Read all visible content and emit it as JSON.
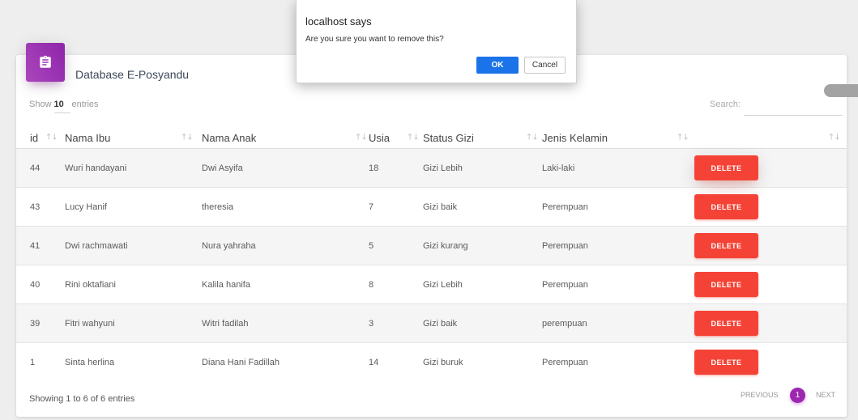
{
  "dialog": {
    "title": "localhost says",
    "message": "Are you sure you want to remove this?",
    "ok_label": "OK",
    "cancel_label": "Cancel"
  },
  "card": {
    "icon": "clipboard-icon",
    "title": "Database E-Posyandu"
  },
  "controls": {
    "show_label": "Show",
    "page_length": "10",
    "entries_label": "entries",
    "search_label": "Search:",
    "search_value": ""
  },
  "table": {
    "sort_icon": "sort-both-icon",
    "columns": [
      {
        "key": "id",
        "label": "id"
      },
      {
        "key": "nama_ibu",
        "label": "Nama Ibu"
      },
      {
        "key": "nama_anak",
        "label": "Nama Anak"
      },
      {
        "key": "usia",
        "label": "Usia"
      },
      {
        "key": "status_gizi",
        "label": "Status Gizi"
      },
      {
        "key": "jenis_kelamin",
        "label": "Jenis Kelamin"
      },
      {
        "key": "action",
        "label": ""
      }
    ],
    "rows": [
      {
        "id": "44",
        "nama_ibu": "Wuri handayani",
        "nama_anak": "Dwi Asyifa",
        "usia": "18",
        "status_gizi": "Gizi Lebih",
        "jenis_kelamin": "Laki-laki",
        "action": "DELETE"
      },
      {
        "id": "43",
        "nama_ibu": "Lucy Hanif",
        "nama_anak": "theresia",
        "usia": "7",
        "status_gizi": "Gizi baik",
        "jenis_kelamin": "Perempuan",
        "action": "DELETE"
      },
      {
        "id": "41",
        "nama_ibu": "Dwi rachmawati",
        "nama_anak": "Nura yahraha",
        "usia": "5",
        "status_gizi": "Gizi kurang",
        "jenis_kelamin": "Perempuan",
        "action": "DELETE"
      },
      {
        "id": "40",
        "nama_ibu": "Rini oktafiani",
        "nama_anak": "Kalila hanifa",
        "usia": "8",
        "status_gizi": "Gizi Lebih",
        "jenis_kelamin": "Perempuan",
        "action": "DELETE"
      },
      {
        "id": "39",
        "nama_ibu": "Fitri wahyuni",
        "nama_anak": "Witri fadilah",
        "usia": "3",
        "status_gizi": "Gizi baik",
        "jenis_kelamin": "perempuan",
        "action": "DELETE"
      },
      {
        "id": "1",
        "nama_ibu": "Sinta herlina",
        "nama_anak": "Diana Hani Fadillah",
        "usia": "14",
        "status_gizi": "Gizi buruk",
        "jenis_kelamin": "Perempuan",
        "action": "DELETE"
      }
    ]
  },
  "footer": {
    "info": "Showing 1 to 6 of 6 entries",
    "previous": "PREVIOUS",
    "current_page": "1",
    "next": "NEXT"
  },
  "colors": {
    "accent_purple": "#9c27b0",
    "delete_red": "#f44336",
    "dialog_ok_blue": "#1a73e8",
    "side_toggle_gray": "#a3a3a3"
  }
}
